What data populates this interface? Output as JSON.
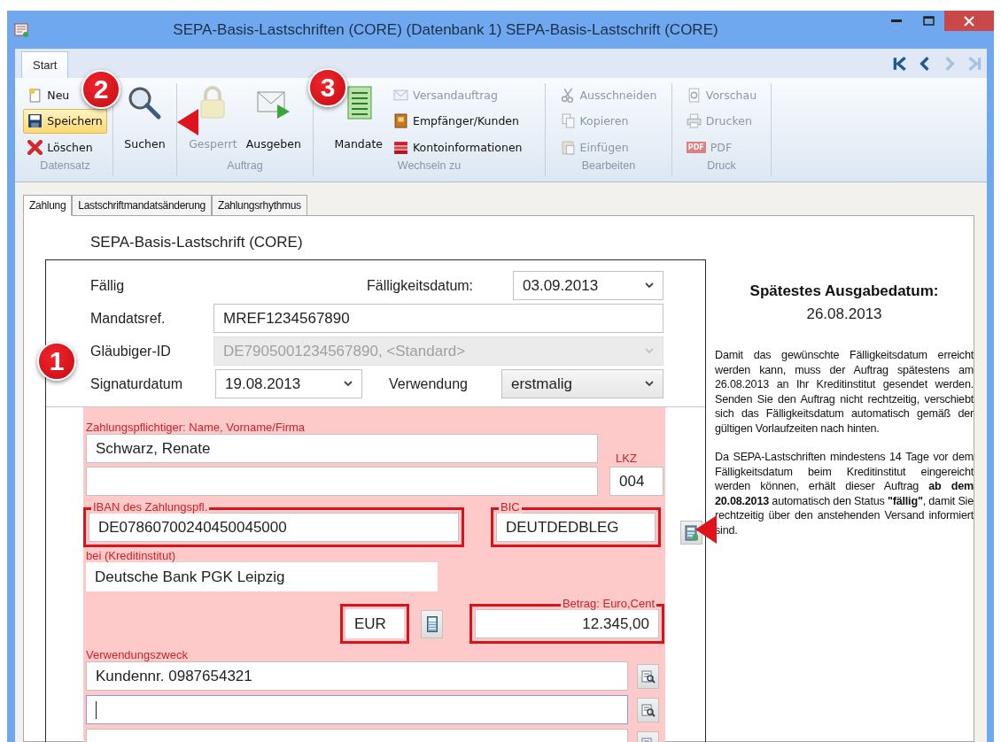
{
  "window": {
    "title": "SEPA-Basis-Lastschriften (CORE) (Datenbank 1) SEPA-Basis-Lastschrift (CORE)"
  },
  "ribbon": {
    "tabs": [
      {
        "label": "Start",
        "selected": true
      }
    ],
    "nav": [
      {
        "disabled": false
      },
      {
        "disabled": false
      },
      {
        "disabled": true
      },
      {
        "disabled": true
      }
    ],
    "groups": [
      {
        "label": "Datensatz",
        "items": [
          {
            "label": "Neu",
            "kind": "small",
            "disabled": false,
            "highlighted": false
          },
          {
            "label": "Speichern",
            "kind": "small",
            "disabled": false,
            "highlighted": true
          },
          {
            "label": "Löschen",
            "kind": "small",
            "disabled": false,
            "highlighted": false
          }
        ]
      },
      {
        "items": [
          {
            "label": "Suchen",
            "kind": "large",
            "disabled": false,
            "highlighted": false
          }
        ]
      },
      {
        "label": "Auftrag",
        "items": [
          {
            "label": "Gesperrt",
            "kind": "large",
            "disabled": true,
            "highlighted": false
          },
          {
            "label": "Ausgeben",
            "kind": "large",
            "disabled": false,
            "highlighted": false
          }
        ]
      },
      {
        "label": "Wechseln zu",
        "items": [
          {
            "label": "Mandate",
            "kind": "large",
            "disabled": false,
            "highlighted": false
          },
          {
            "label": "Versandauftrag",
            "kind": "small",
            "disabled": true,
            "highlighted": false
          },
          {
            "label": "Empfänger/Kunden",
            "kind": "small",
            "disabled": false,
            "highlighted": false
          },
          {
            "label": "Kontoinformationen",
            "kind": "small",
            "disabled": false,
            "highlighted": false
          }
        ]
      },
      {
        "label": "Bearbeiten",
        "items": [
          {
            "label": "Ausschneiden",
            "kind": "small",
            "disabled": true,
            "highlighted": false
          },
          {
            "label": "Kopieren",
            "kind": "small",
            "disabled": true,
            "highlighted": false
          },
          {
            "label": "Einfügen",
            "kind": "small",
            "disabled": true,
            "highlighted": false
          }
        ]
      },
      {
        "label": "Druck",
        "items": [
          {
            "label": "Vorschau",
            "kind": "small",
            "disabled": true,
            "highlighted": false
          },
          {
            "label": "Drucken",
            "kind": "small",
            "disabled": true,
            "highlighted": false
          },
          {
            "label": "PDF",
            "kind": "small",
            "disabled": true,
            "highlighted": false,
            "icon_text": "PDF"
          }
        ]
      }
    ]
  },
  "form_tabs": [
    {
      "label": "Zahlung",
      "selected": true
    },
    {
      "label": "Lastschriftmandatsänderung",
      "selected": false
    },
    {
      "label": "Zahlungsrhythmus",
      "selected": false
    }
  ],
  "form": {
    "section_title": "SEPA-Basis-Lastschrift (CORE)",
    "status_label": "Fällig",
    "due_date": {
      "label": "Fälligkeitsdatum:",
      "value": "03.09.2013"
    },
    "mandate_ref": {
      "label": "Mandatsref.",
      "value": "MREF1234567890"
    },
    "creditor_id": {
      "label": "Gläubiger-ID",
      "value": "DE7905001234567890, <Standard>",
      "disabled": true
    },
    "signature_date": {
      "label": "Signaturdatum",
      "value": "19.08.2013"
    },
    "usage": {
      "label": "Verwendung",
      "value": "erstmalig"
    },
    "payer": {
      "label": "Zahlungspflichtiger: Name, Vorname/Firma",
      "name": "Schwarz, Renate"
    },
    "country": {
      "label": "LKZ",
      "value": "004"
    },
    "iban": {
      "label": "IBAN des Zahlungspfl.",
      "value": "DE07860700240450045000",
      "highlighted": true
    },
    "bic": {
      "label": "BIC",
      "value": "DEUTDEDBLEG",
      "highlighted": true
    },
    "bank": {
      "label": "bei (Kreditinstitut)",
      "value": "Deutsche Bank PGK Leipzig"
    },
    "currency": {
      "value": "EUR",
      "highlighted": true
    },
    "amount": {
      "label": "Betrag: Euro,Cent",
      "value": "12.345,00",
      "highlighted": true
    },
    "purpose": {
      "label": "Verwendungszweck",
      "lines": [
        {
          "value": "Kundennr. 0987654321",
          "focused": false
        },
        {
          "focused": true
        },
        {
          "focused": false
        }
      ]
    }
  },
  "info": {
    "title": "Spätestes Ausgabedatum:",
    "date": "26.08.2013",
    "paragraphs": [
      "Damit das gewünschte Fälligkeitsdatum erreicht werden kann, muss der Auftrag spätestens am 26.08.2013 an Ihr Kreditinstitut gesendet werden. Senden Sie den Auftrag nicht rechtzeitig, verschiebt sich das Fälligkeitsdatum automatisch gemäß der gültigen Vorlaufzeiten nach hinten.",
      "Da SEPA-Lastschriften mindestens 14 Tage vor dem Fälligkeitsdatum beim Kreditinstitut eingereicht werden können, erhält dieser Auftrag **ab dem 20.08.2013** automatisch den Status **\"fällig\"**, damit Sie rechtzeitig über den anstehenden Versand informiert sind."
    ]
  },
  "callouts": [
    {
      "number": "1"
    },
    {
      "number": "2"
    },
    {
      "number": "3"
    }
  ]
}
